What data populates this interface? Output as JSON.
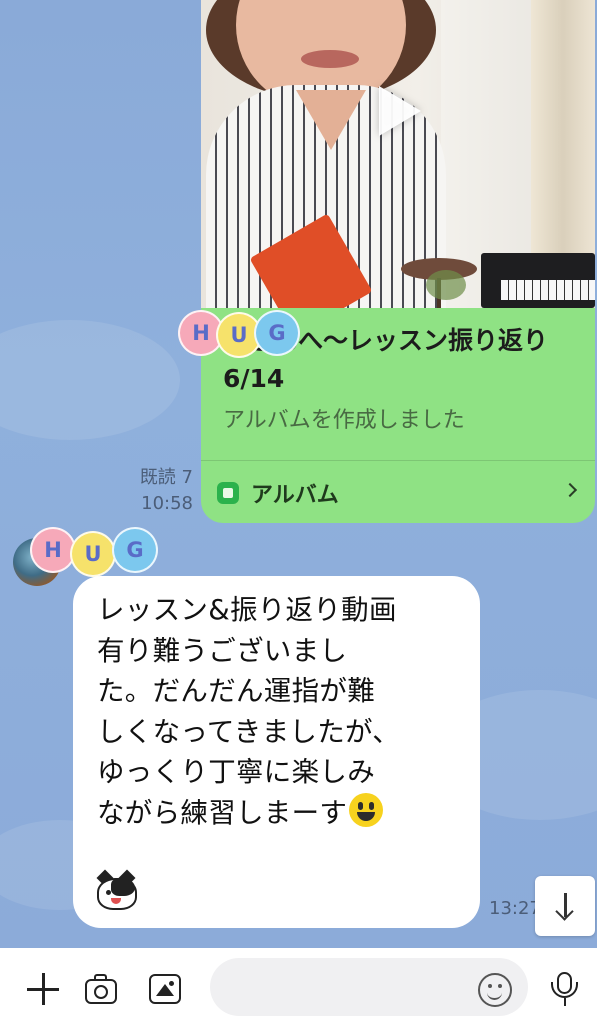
{
  "album_message": {
    "title": "様さんへ〜レッスン振り返り6/14",
    "subtitle": "アルバムを作成しました",
    "footer_label": "アルバム",
    "sticker_letters": [
      "H",
      "U",
      "G"
    ]
  },
  "read_receipt": {
    "read_text": "既読 7",
    "time": "10:58"
  },
  "incoming_message": {
    "sticker_letters": [
      "H",
      "U",
      "G"
    ],
    "text": "レッスン&振り返り動画\n有り難うございまし\nた。だんだん運指が難\nしくなってきましたが、\nゆっくり丁寧に楽しみ\nながら練習しまーす",
    "time": "13:27"
  },
  "input_bar": {
    "placeholder": ""
  },
  "colors": {
    "chat_background": "#8cabd9",
    "outgoing_bubble": "#8fe284",
    "incoming_bubble": "#ffffff",
    "album_icon": "#2bb24c"
  }
}
